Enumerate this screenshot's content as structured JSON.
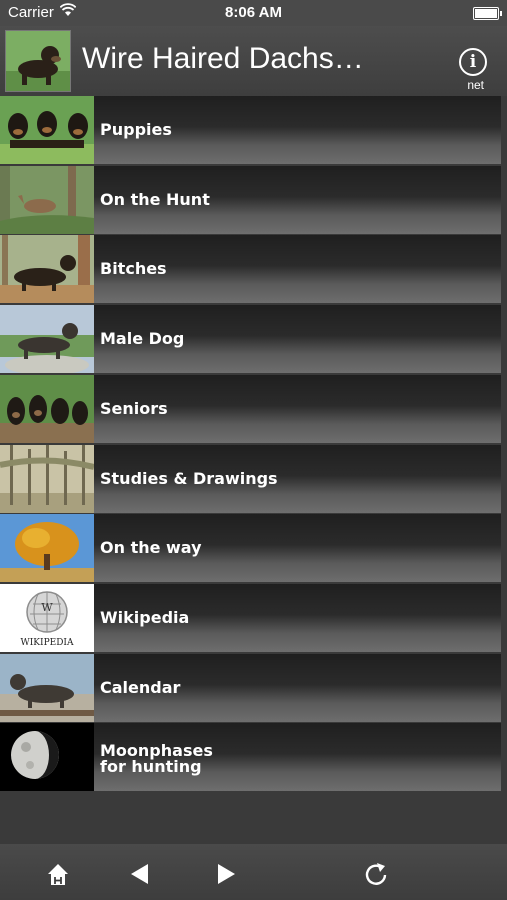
{
  "status_bar": {
    "carrier": "Carrier",
    "time": "8:06 AM"
  },
  "header": {
    "title": "Wire Haired Dachs…",
    "info_label": "net"
  },
  "menu": [
    {
      "label": "Puppies",
      "image": "puppies-photo"
    },
    {
      "label": "On the Hunt",
      "image": "hunt-photo"
    },
    {
      "label": "Bitches",
      "image": "bitch-photo"
    },
    {
      "label": "Male Dog",
      "image": "male-dog-photo"
    },
    {
      "label": "Seniors",
      "image": "seniors-photo"
    },
    {
      "label": "Studies & Drawings",
      "image": "forest-drawing"
    },
    {
      "label": "On the way",
      "image": "autumn-tree-photo"
    },
    {
      "label": "Wikipedia",
      "image": "wikipedia-logo",
      "logo_text": "WIKIPEDIA"
    },
    {
      "label": "Calendar",
      "image": "calendar-dog-photo"
    },
    {
      "label": "Moonphases\nfor hunting",
      "image": "moon-photo"
    }
  ],
  "toolbar": {
    "home": "home-icon",
    "back": "back-arrow-icon",
    "forward": "forward-arrow-icon",
    "refresh": "refresh-icon"
  }
}
